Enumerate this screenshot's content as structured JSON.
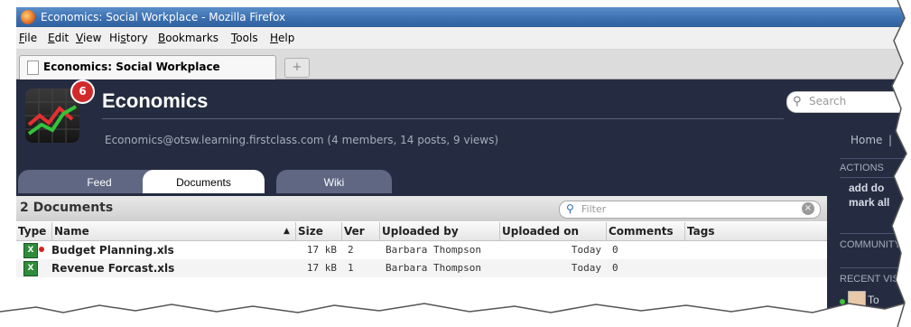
{
  "window": {
    "title": "Economics: Social Workplace - Mozilla Firefox"
  },
  "menu": [
    {
      "key": "F",
      "rest": "ile"
    },
    {
      "key": "E",
      "rest": "dit"
    },
    {
      "key": "V",
      "rest": "iew"
    },
    {
      "pre": "Hi",
      "key": "s",
      "rest": "tory"
    },
    {
      "key": "B",
      "rest": "ookmarks"
    },
    {
      "key": "T",
      "rest": "ools"
    },
    {
      "key": "H",
      "rest": "elp"
    }
  ],
  "browser_tab": {
    "label": "Economics: Social Workplace",
    "new_tab": "+"
  },
  "group": {
    "badge": "6",
    "title": "Economics",
    "info": "Economics@otsw.learning.firstclass.com (4 members, 14 posts, 9 views)"
  },
  "search": {
    "placeholder": "Search"
  },
  "nav": {
    "home": "Home",
    "sep": "|"
  },
  "tabs": [
    {
      "label": "Feed",
      "active": false
    },
    {
      "label": "Documents",
      "active": true
    },
    {
      "label": "Wiki",
      "active": false
    }
  ],
  "side": {
    "actions": "ACTIONS",
    "add": "add do",
    "mark": "mark all",
    "community": "COMMUNITY",
    "recent": "RECENT VIS",
    "recent_item": "To"
  },
  "documents": {
    "count_label": "2 Documents",
    "filter_placeholder": "Filter",
    "columns": [
      "Type",
      "Name",
      "▲",
      "Size",
      "Ver",
      "Uploaded by",
      "Uploaded on",
      "Comments",
      "Tags"
    ],
    "rows": [
      {
        "icon": "excel-file-icon",
        "flag": true,
        "name": "Budget Planning.xls",
        "size": "17 kB",
        "ver": "2",
        "by": "Barbara Thompson",
        "on": "Today",
        "comments": "0",
        "tags": ""
      },
      {
        "icon": "excel-file-icon",
        "flag": false,
        "name": "Revenue Forcast.xls",
        "size": "17 kB",
        "ver": "1",
        "by": "Barbara Thompson",
        "on": "Today",
        "comments": "0",
        "tags": ""
      }
    ]
  },
  "colors": {
    "app_bg": "#252c41",
    "tab_inactive": "#5f6783",
    "badge": "#d22a2a"
  }
}
